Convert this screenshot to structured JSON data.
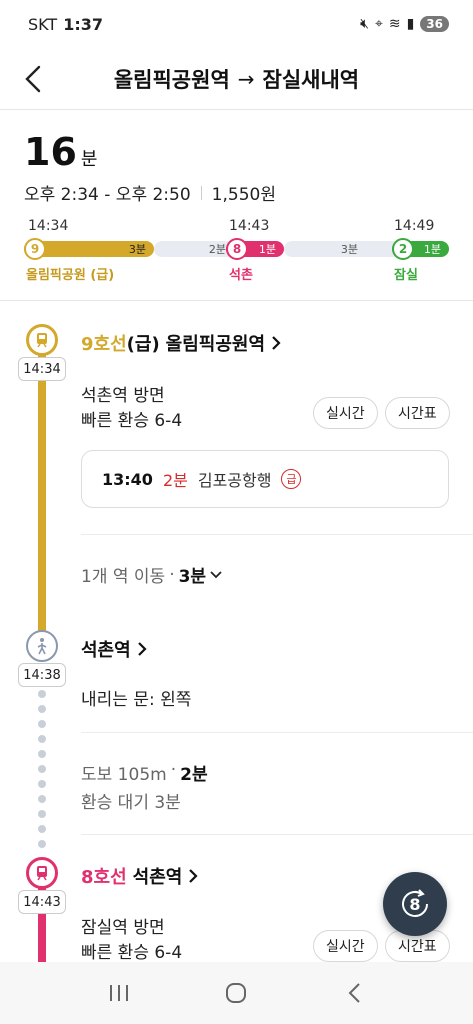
{
  "status": {
    "carrier": "SKT",
    "time": "1:37",
    "battery": "36"
  },
  "header": {
    "from": "올림픽공원역",
    "arrow": "→",
    "to": "잠실새내역"
  },
  "summary": {
    "duration_num": "16",
    "duration_unit": "분",
    "timespan": "오후 2:34 - 오후 2:50",
    "fare": "1,550원"
  },
  "bar": {
    "times": [
      "14:34",
      "14:43",
      "14:49"
    ],
    "segments": [
      {
        "line": "9",
        "color": "#d4a82a",
        "ride": "3분",
        "walk": "2분"
      },
      {
        "line": "8",
        "color": "#e0306e",
        "ride": "1분",
        "walk": "3분"
      },
      {
        "line": "2",
        "color": "#3aaa3e",
        "ride": "1분"
      }
    ],
    "labels": [
      "올림픽공원 (급)",
      "석촌",
      "잠실"
    ]
  },
  "colors": {
    "line9": "#d4a82a",
    "line8": "#e0306e",
    "line2": "#3aaa3e",
    "red": "#d72b2b",
    "gray": "#8a97ad"
  },
  "route": {
    "seg1": {
      "time": "14:34",
      "line_name": "9호선",
      "express": "(급)",
      "station": "올림픽공원역",
      "direction": "석촌역 방면",
      "transfer": "빠른 환승 6-4",
      "realtime_btn": "실시간",
      "timetable_btn": "시간표",
      "arrival_time": "13:40",
      "arrival_min": "2분",
      "arrival_dest": "김포공항행",
      "express_badge": "급",
      "move_text": "1개 역 이동",
      "move_dot": "·",
      "move_time": "3분"
    },
    "walk": {
      "time": "14:38",
      "station": "석촌역",
      "door": "내리는 문: 왼쪽",
      "walk_text": "도보 105m",
      "walk_dot": "·",
      "walk_time": "2분",
      "wait": "환승 대기 3분"
    },
    "seg2": {
      "time": "14:43",
      "line_name": "8호선",
      "station": "석촌역",
      "direction": "잠실역 방면",
      "transfer": "빠른 환승 6-4",
      "realtime_btn": "실시간",
      "timetable_btn": "시간표"
    }
  },
  "fab": {
    "label": "8"
  }
}
